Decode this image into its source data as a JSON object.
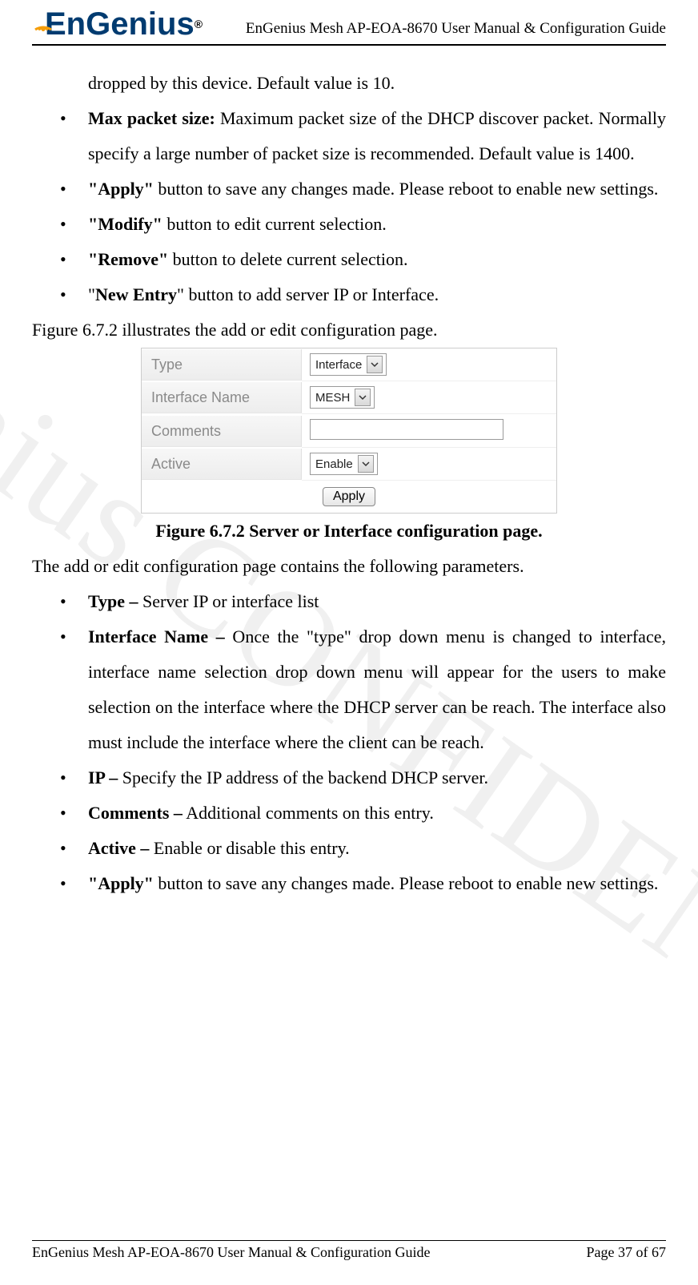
{
  "header": {
    "logo_text": "EnGenius",
    "logo_reg": "®",
    "doc_title": "EnGenius Mesh AP-EOA-8670 User Manual & Configuration Guide"
  },
  "watermark": "EnGenius CONFIDENTIAL",
  "body": {
    "first_line": "dropped by this device. Default value is 10.",
    "bullets_top": [
      {
        "bold": "Max packet size:",
        "rest": " Maximum packet size of the DHCP discover packet. Normally specify a large number of packet size is recommended. Default value is 1400."
      },
      {
        "bold": "\"Apply\"",
        "rest": " button to save any changes made. Please reboot to enable new settings."
      },
      {
        "bold": "\"Modify\"",
        "rest": " button to edit current selection."
      },
      {
        "bold": "\"Remove\"",
        "rest": " button to delete current selection."
      },
      {
        "pre": "\"",
        "bold": "New Entry",
        "post": "\" button to add server IP or Interface."
      }
    ],
    "fig_ref": "Figure 6.7.2 illustrates the add or edit configuration page.",
    "fig_caption": "Figure 6.7.2 Server or Interface configuration page.",
    "intro2": "The add or edit configuration page contains the following parameters.",
    "bullets_bottom": [
      {
        "bold": "Type –",
        "rest": " Server IP or interface list"
      },
      {
        "bold": "Interface Name –",
        "rest": " Once the \"type\" drop down menu is changed to interface, interface name selection drop down menu will appear for the users to make selection on the interface where the DHCP server can be reach. The interface also must include the interface where the client can be reach."
      },
      {
        "bold": "IP –",
        "rest": " Specify the IP address of the backend DHCP server."
      },
      {
        "bold": "Comments –",
        "rest": " Additional comments on this entry."
      },
      {
        "bold": "Active –",
        "rest": " Enable or disable this entry."
      },
      {
        "bold": "\"Apply\"",
        "rest": " button to save any changes made. Please reboot to enable new settings."
      }
    ]
  },
  "ui": {
    "rows": {
      "type": {
        "label": "Type",
        "value": "Interface"
      },
      "ifname": {
        "label": "Interface Name",
        "value": "MESH"
      },
      "comments": {
        "label": "Comments",
        "value": ""
      },
      "active": {
        "label": "Active",
        "value": "Enable"
      }
    },
    "apply_label": "Apply"
  },
  "footer": {
    "left": "EnGenius Mesh AP-EOA-8670 User Manual & Configuration Guide",
    "right": "Page 37 of 67"
  }
}
